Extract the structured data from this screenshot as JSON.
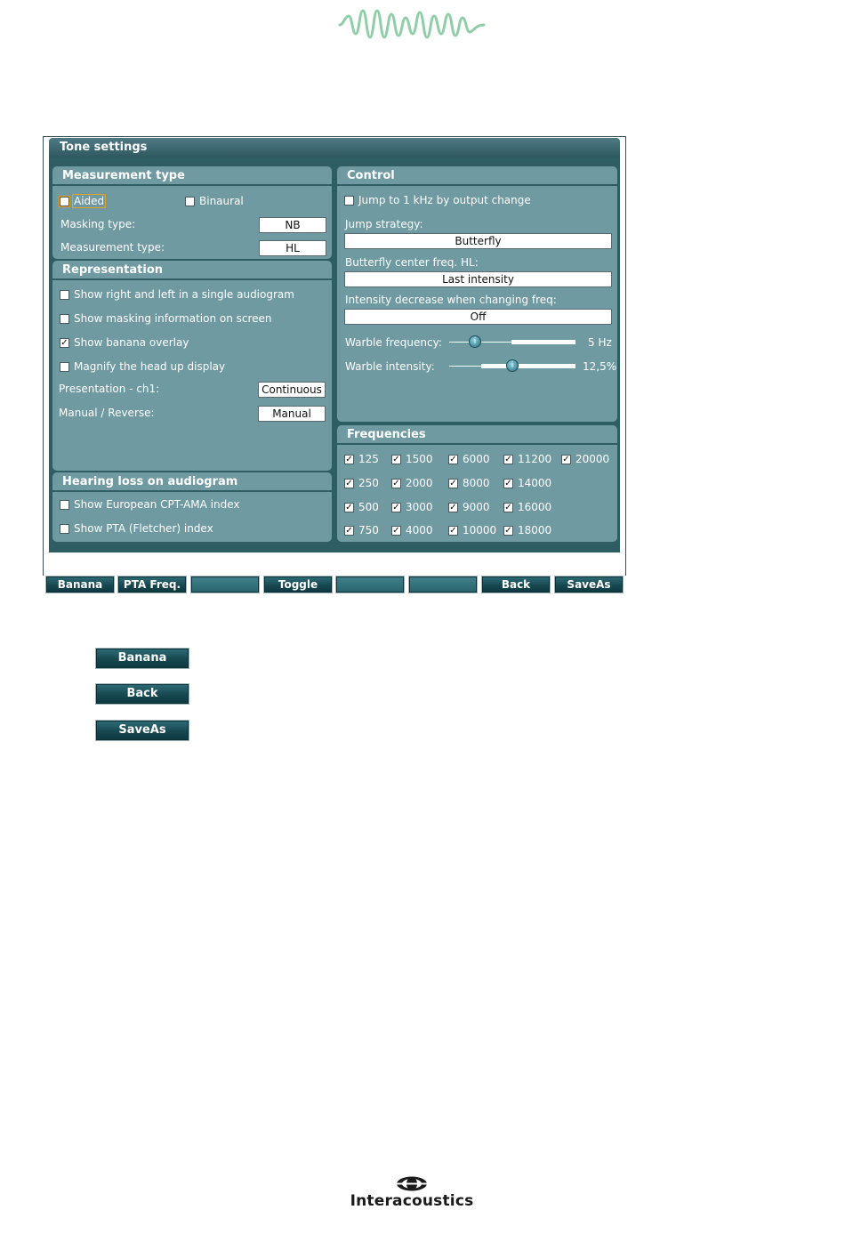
{
  "window": {
    "title": "Tone settings"
  },
  "measurement": {
    "header": "Measurement type",
    "aided": {
      "label": "Aided",
      "checked": false
    },
    "binaural": {
      "label": "Binaural",
      "checked": false
    },
    "masking_label": "Masking type:",
    "masking_value": "NB",
    "mtype_label": "Measurement type:",
    "mtype_value": "HL"
  },
  "representation": {
    "header": "Representation",
    "items": [
      {
        "label": "Show right and left in a single audiogram",
        "checked": false
      },
      {
        "label": "Show masking information on screen",
        "checked": false
      },
      {
        "label": "Show banana overlay",
        "checked": true
      },
      {
        "label": "Magnify the head up display",
        "checked": false
      }
    ],
    "presentation_label": "Presentation - ch1:",
    "presentation_value": "Continuous",
    "manual_label": "Manual / Reverse:",
    "manual_value": "Manual"
  },
  "hearing_loss": {
    "header": "Hearing loss on audiogram",
    "items": [
      {
        "label": "Show European CPT-AMA index",
        "checked": false
      },
      {
        "label": "Show PTA (Fletcher) index",
        "checked": false
      }
    ]
  },
  "control": {
    "header": "Control",
    "jump_1khz": {
      "label": "Jump to 1 kHz by output change",
      "checked": false
    },
    "jump_strategy_label": "Jump strategy:",
    "jump_strategy_value": "Butterfly",
    "butterfly_label": "Butterfly center freq. HL:",
    "butterfly_value": "Last intensity",
    "intensity_label": "Intensity decrease when changing freq:",
    "intensity_value": "Off",
    "warble_freq_label": "Warble frequency:",
    "warble_freq_value": "5 Hz",
    "warble_int_label": "Warble intensity:",
    "warble_int_value": "12,5%"
  },
  "frequencies": {
    "header": "Frequencies",
    "columns": [
      [
        "125",
        "250",
        "500",
        "750"
      ],
      [
        "1500",
        "2000",
        "3000",
        "4000"
      ],
      [
        "6000",
        "8000",
        "9000",
        "10000"
      ],
      [
        "11200",
        "14000",
        "16000",
        "18000"
      ],
      [
        "20000"
      ]
    ]
  },
  "toolbar": {
    "buttons": [
      "Banana",
      "PTA Freq.",
      "",
      "Toggle",
      "",
      "",
      "Back",
      "SaveAs"
    ]
  },
  "legend_buttons": [
    "Banana",
    "Back",
    "SaveAs"
  ],
  "brand": {
    "name": "Interacoustics"
  }
}
